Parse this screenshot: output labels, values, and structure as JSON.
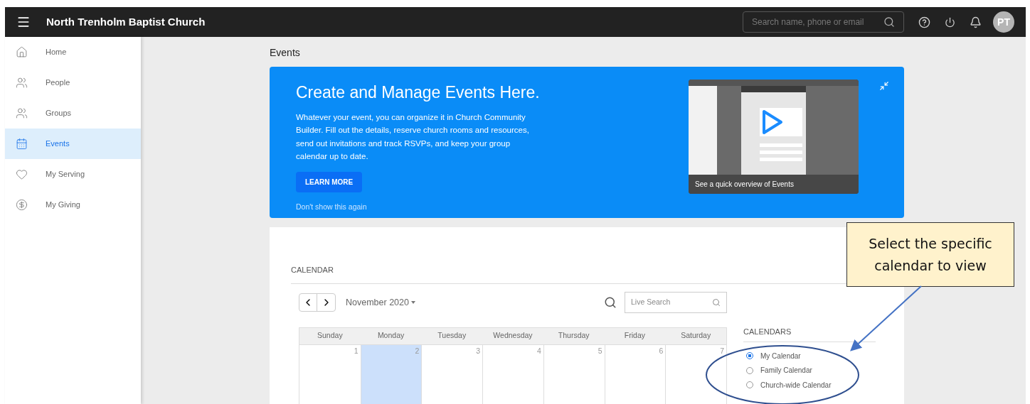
{
  "header": {
    "title": "North Trenholm Baptist Church",
    "search": {
      "placeholder": "Search name, phone or email"
    },
    "avatar": "PT"
  },
  "sidebar": {
    "items": [
      {
        "label": "Home",
        "selected": false
      },
      {
        "label": "People",
        "selected": false
      },
      {
        "label": "Groups",
        "selected": false
      },
      {
        "label": "Events",
        "selected": true
      },
      {
        "label": "My Serving",
        "selected": false
      },
      {
        "label": "My Giving",
        "selected": false
      }
    ]
  },
  "page_title": "Events",
  "banner": {
    "title": "Create and Manage Events Here.",
    "text": "Whatever your event, you can organize it in Church Community Builder. Fill out the details, reserve church rooms and resources, send out invitations and track RSVPs, and keep your group calendar up to date.",
    "button": "LEARN MORE",
    "dismiss": "Don't show this again",
    "video_caption": "See a quick overview of Events"
  },
  "calendar": {
    "heading": "CALENDAR",
    "month": "November 2020",
    "search": {
      "placeholder": "Live Search"
    },
    "days": [
      "Sunday",
      "Monday",
      "Tuesday",
      "Wednesday",
      "Thursday",
      "Friday",
      "Saturday"
    ],
    "cells": [
      {
        "day": "1",
        "selected": false
      },
      {
        "day": "2",
        "selected": true
      },
      {
        "day": "3",
        "selected": false
      },
      {
        "day": "4",
        "selected": false
      },
      {
        "day": "5",
        "selected": false
      },
      {
        "day": "6",
        "selected": false
      },
      {
        "day": "7",
        "selected": false
      }
    ],
    "calendars_heading": "CALENDARS",
    "calendars": [
      {
        "label": "My Calendar",
        "selected": true
      },
      {
        "label": "Family Calendar",
        "selected": false
      },
      {
        "label": "Church-wide Calendar",
        "selected": false
      }
    ]
  },
  "callout": "Select the specific calendar to view"
}
